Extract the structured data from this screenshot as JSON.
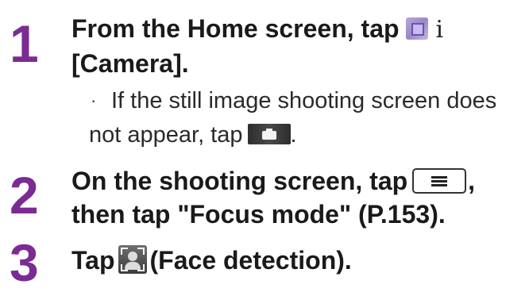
{
  "steps": [
    {
      "number": "1",
      "line1_prefix": "From the Home screen, tap",
      "home_icon": "home-apps-icon",
      "faint_glyph": "i",
      "line2": "[Camera].",
      "note_prefix": "If the still image shooting screen does",
      "note_line2_prefix": "not appear, tap",
      "note_icon": "camera-mode-icon",
      "note_suffix": ".",
      "bullet": "·"
    },
    {
      "number": "2",
      "line1_prefix": "On the shooting screen, tap",
      "menu_icon": "menu-key-icon",
      "line1_suffix": ",",
      "line2": "then tap \"Focus mode\" (P.153)."
    },
    {
      "number": "3",
      "line1_prefix": "Tap",
      "face_icon": "face-detection-icon",
      "line1_suffix": "(Face detection)."
    }
  ],
  "colors": {
    "step_number": "#7b2c93",
    "text": "#1a1a1a"
  }
}
